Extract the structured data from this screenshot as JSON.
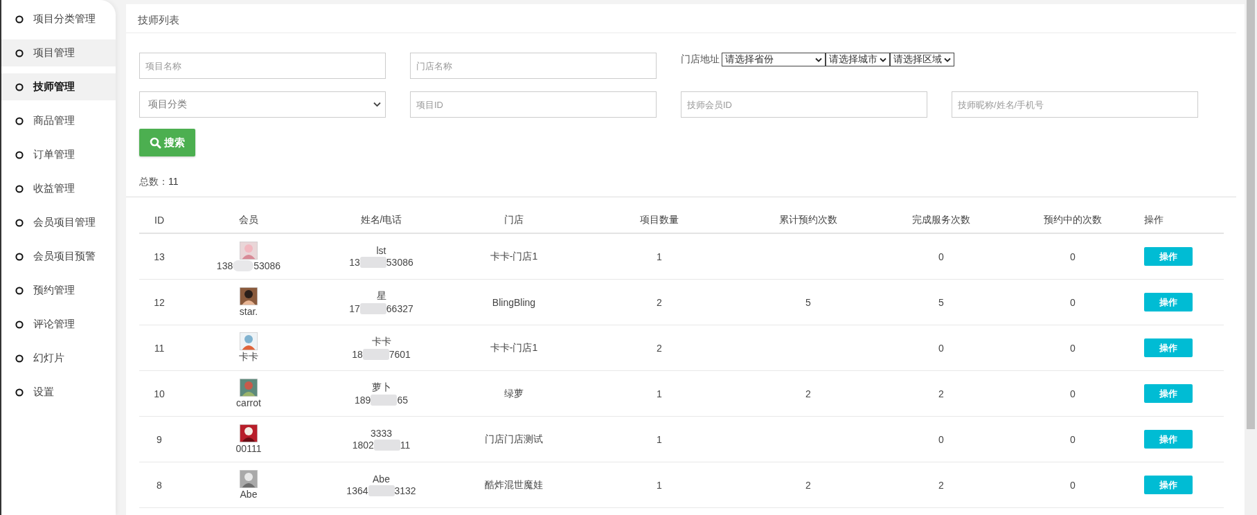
{
  "sidebar": {
    "items": [
      {
        "label": "项目分类管理",
        "selected": false,
        "hovered": false
      },
      {
        "label": "项目管理",
        "selected": false,
        "hovered": true
      },
      {
        "label": "技师管理",
        "selected": true,
        "hovered": false
      },
      {
        "label": "商品管理",
        "selected": false,
        "hovered": false
      },
      {
        "label": "订单管理",
        "selected": false,
        "hovered": false
      },
      {
        "label": "收益管理",
        "selected": false,
        "hovered": false
      },
      {
        "label": "会员项目管理",
        "selected": false,
        "hovered": false
      },
      {
        "label": "会员项目预警",
        "selected": false,
        "hovered": false
      },
      {
        "label": "预约管理",
        "selected": false,
        "hovered": false
      },
      {
        "label": "评论管理",
        "selected": false,
        "hovered": false
      },
      {
        "label": "幻灯片",
        "selected": false,
        "hovered": false
      },
      {
        "label": "设置",
        "selected": false,
        "hovered": false
      }
    ]
  },
  "panel": {
    "title": "技师列表"
  },
  "filters": {
    "project_name": {
      "placeholder": "项目名称"
    },
    "store_name": {
      "placeholder": "门店名称"
    },
    "address_label": "门店地址",
    "address_selects": [
      "请选择省份",
      "请选择城市",
      "请选择区域"
    ],
    "category": {
      "value": "项目分类"
    },
    "project_id": {
      "placeholder": "项目ID"
    },
    "member_id": {
      "placeholder": "技师会员ID"
    },
    "keyword": {
      "placeholder": "技师昵称/姓名/手机号"
    },
    "search_button": "搜索"
  },
  "total": {
    "label": "总数：",
    "value": "11"
  },
  "table": {
    "columns": [
      "ID",
      "会员",
      "姓名/电话",
      "门店",
      "项目数量",
      "累计预约次数",
      "完成服务次数",
      "预约中的次数",
      "操作"
    ],
    "rows": [
      {
        "id": "13",
        "member": {
          "phone_start": "138",
          "phone_end": "53086",
          "kind": "phone"
        },
        "name": "lst",
        "phone_start": "13",
        "phone_end": "53086",
        "store": "卡卡-门店1",
        "projects": "1",
        "booked": "",
        "done": "0",
        "pending": "0",
        "action": "操作"
      },
      {
        "id": "12",
        "member": {
          "name": "star.",
          "kind": "name"
        },
        "name": "星",
        "phone_start": "17",
        "phone_end": "66327",
        "store": "BlingBling",
        "projects": "2",
        "booked": "5",
        "done": "5",
        "pending": "0",
        "action": "操作"
      },
      {
        "id": "11",
        "member": {
          "name": "卡卡",
          "kind": "name"
        },
        "name": "卡卡",
        "phone_start": "18",
        "phone_end": "7601",
        "store": "卡卡-门店1",
        "projects": "2",
        "booked": "",
        "done": "0",
        "pending": "0",
        "action": "操作"
      },
      {
        "id": "10",
        "member": {
          "name": "carrot",
          "kind": "name"
        },
        "name": "萝卜",
        "phone_start": "189",
        "phone_end": "65",
        "store": "绿萝",
        "projects": "1",
        "booked": "2",
        "done": "2",
        "pending": "0",
        "action": "操作"
      },
      {
        "id": "9",
        "member": {
          "name": "00111",
          "kind": "name"
        },
        "name": "3333",
        "phone_start": "1802",
        "phone_end": "11",
        "store": "门店门店测试",
        "projects": "1",
        "booked": "",
        "done": "0",
        "pending": "0",
        "action": "操作"
      },
      {
        "id": "8",
        "member": {
          "name": "Abe",
          "kind": "name"
        },
        "name": "Abe",
        "phone_start": "1364",
        "phone_end": "3132",
        "store": "酷炸混世魔娃",
        "projects": "1",
        "booked": "2",
        "done": "2",
        "pending": "0",
        "action": "操作"
      }
    ]
  }
}
